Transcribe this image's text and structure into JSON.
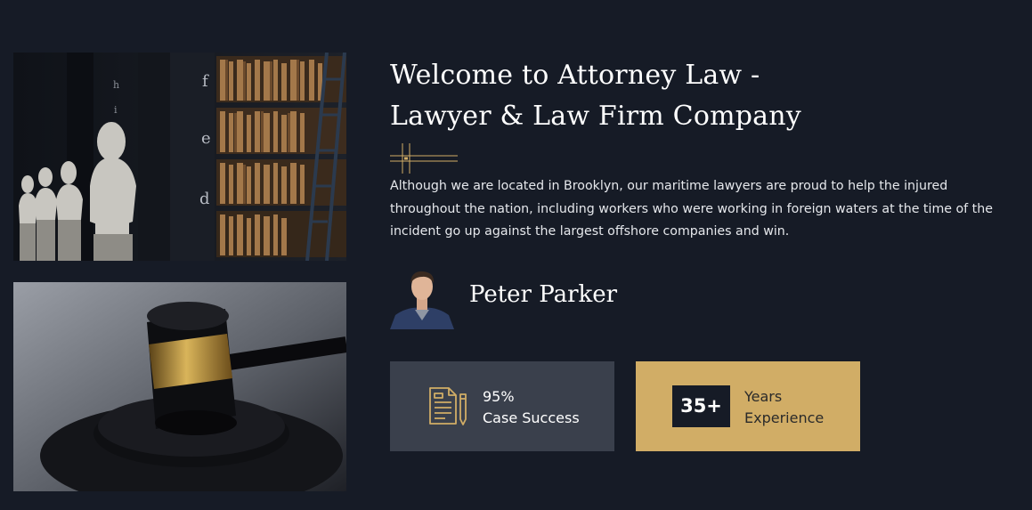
{
  "welcome": {
    "title_line1": "Welcome to Attorney Law -",
    "title_line2": "Lawyer & Law Firm Company",
    "description": "Although we are located in Brooklyn, our maritime lawyers are proud to help the injured throughout the nation, including workers who were working in foreign waters at the time of the incident go up against the largest offshore companies and win."
  },
  "author": {
    "name": "Peter Parker"
  },
  "stats": {
    "success_value": "95%",
    "success_label": "Case Success",
    "years_value": "35+",
    "years_label_line1": "Years",
    "years_label_line2": "Experience"
  },
  "colors": {
    "background": "#161b26",
    "accent_gold": "#d1ad66",
    "card_gray": "#3a404c"
  },
  "icons": {
    "success": "document-pencil-icon",
    "divider": "gold-ornament-icon"
  }
}
